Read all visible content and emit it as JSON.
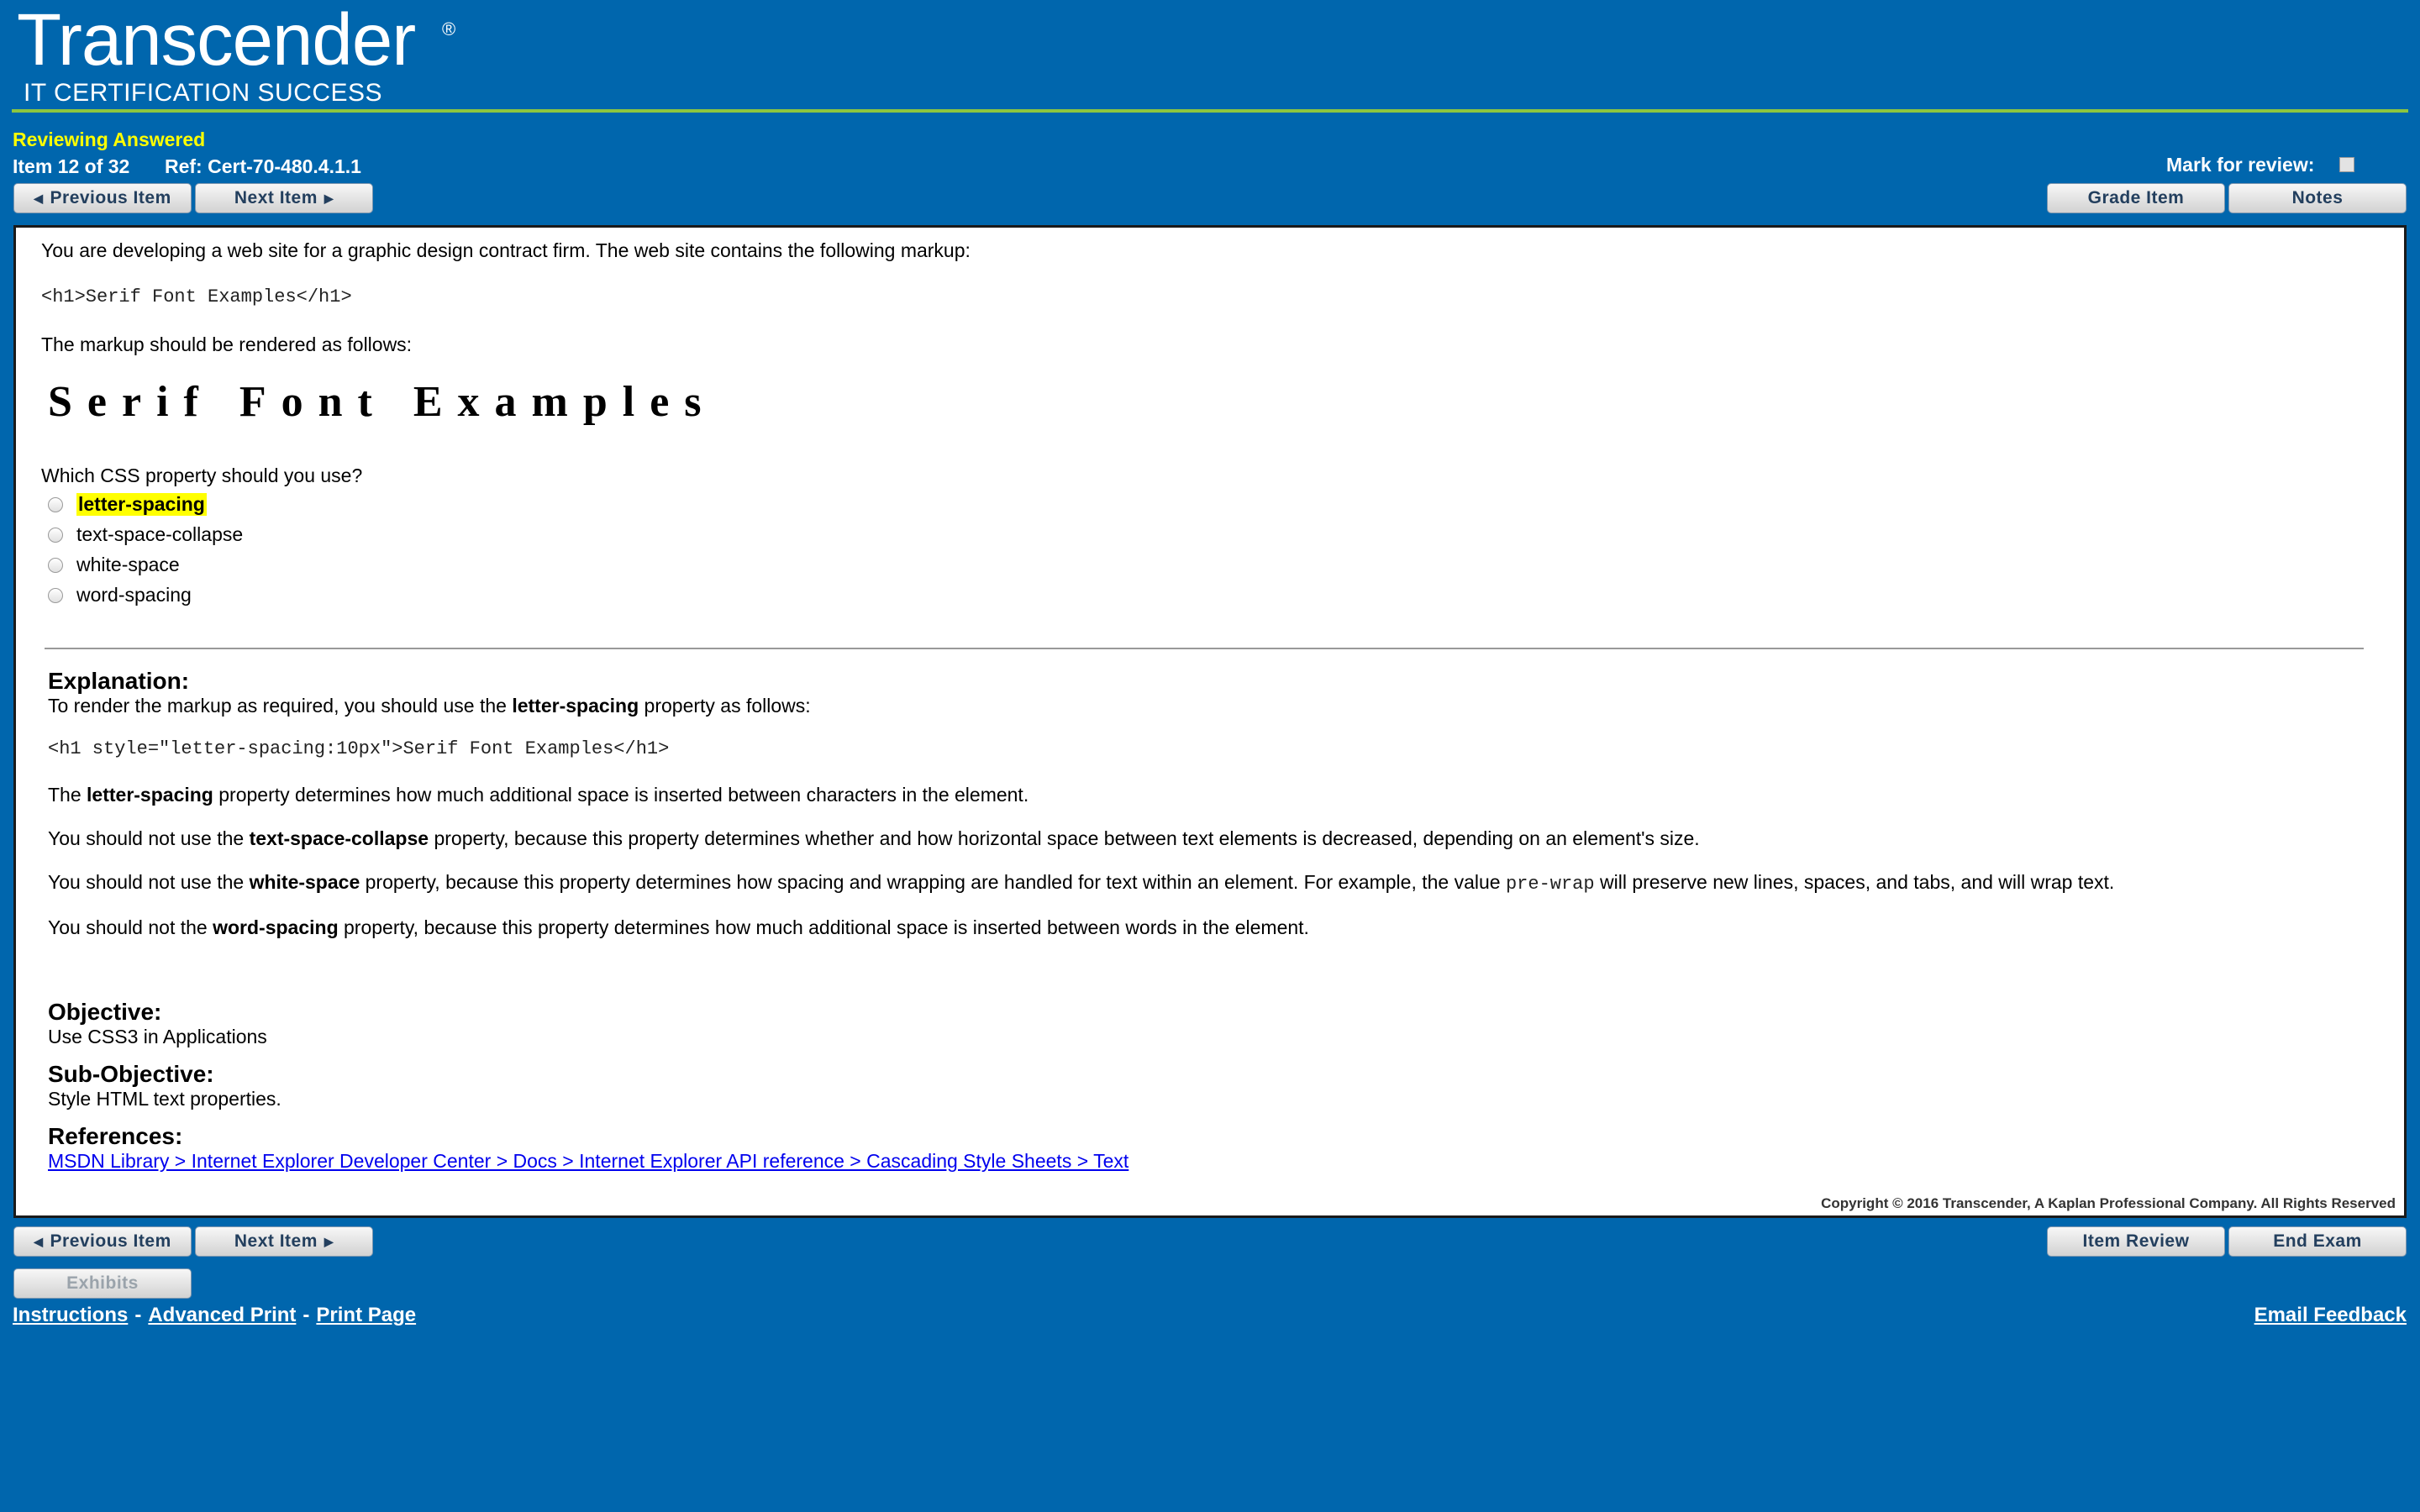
{
  "header": {
    "logo_title": "Transcender",
    "logo_reg": "®",
    "logo_subtitle": "IT CERTIFICATION SUCCESS"
  },
  "status": "Reviewing Answered",
  "item": {
    "position": "Item 12 of 32",
    "ref": "Ref: Cert-70-480.4.1.1"
  },
  "mark_for_review_label": "Mark for review:",
  "top_buttons": {
    "previous": "Previous Item",
    "next": "Next Item",
    "grade": "Grade Item",
    "notes": "Notes"
  },
  "question": {
    "intro": "You are developing a web site for a graphic design contract firm. The web site contains the following markup:",
    "markup": "<h1>Serif Font Examples</h1>",
    "render_intro": "The markup should be rendered as follows:",
    "rendered_demo": "Serif Font Examples",
    "prompt": "Which CSS property should you use?",
    "options": [
      {
        "label": "letter-spacing",
        "highlighted": true
      },
      {
        "label": "text-space-collapse",
        "highlighted": false
      },
      {
        "label": "white-space",
        "highlighted": false
      },
      {
        "label": "word-spacing",
        "highlighted": false
      }
    ]
  },
  "explanation": {
    "heading": "Explanation:",
    "line1_pre": "To render the markup as required, you should use the ",
    "line1_bold": "letter-spacing",
    "line1_post": " property as follows:",
    "code": "<h1 style=\"letter-spacing:10px\">Serif Font Examples</h1>",
    "p1_pre": "The ",
    "p1_bold": "letter-spacing",
    "p1_post": " property determines how much additional space is inserted between characters in the element.",
    "p2_pre": "You should not use the ",
    "p2_bold": "text-space-collapse",
    "p2_post": " property, because this property determines whether and how horizontal space between text elements is decreased, depending on an element's size.",
    "p3_pre": "You should not use the ",
    "p3_bold": "white-space",
    "p3_mid": " property, because this property determines how spacing and wrapping are handled for text within an element. For example, the value ",
    "p3_code": "pre-wrap",
    "p3_post": " will preserve new lines, spaces, and tabs, and will wrap text.",
    "p4_pre": "You should not the ",
    "p4_bold": "word-spacing",
    "p4_post": " property, because this property determines how much additional space is inserted between words in the element."
  },
  "objective": {
    "heading": "Objective:",
    "text": "Use CSS3 in Applications"
  },
  "sub_objective": {
    "heading": "Sub-Objective:",
    "text": "Style HTML text properties."
  },
  "references": {
    "heading": "References:",
    "link": "MSDN Library > Internet Explorer Developer Center > Docs > Internet Explorer API reference > Cascading Style Sheets > Text"
  },
  "copyright": "Copyright © 2016 Transcender, A Kaplan Professional Company. All Rights Reserved",
  "bottom_buttons": {
    "previous": "Previous Item",
    "next": "Next Item",
    "item_review": "Item Review",
    "end_exam": "End Exam",
    "exhibits": "Exhibits"
  },
  "footer": {
    "instructions": "Instructions",
    "sep": "-",
    "advanced_print": "Advanced Print",
    "print_page": "Print Page",
    "email_feedback": "Email Feedback"
  }
}
